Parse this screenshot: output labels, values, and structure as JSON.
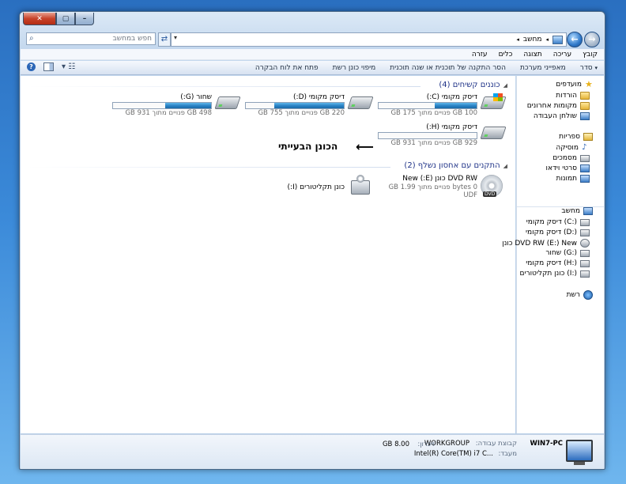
{
  "window": {
    "address": {
      "breadcrumb": "מחשב",
      "search_placeholder": "חפש במחשב"
    },
    "menu": [
      "קובץ",
      "עריכה",
      "תצוגה",
      "כלים",
      "עזרה"
    ],
    "toolbar": [
      "סדר",
      "מאפייני מערכת",
      "הסר התקנה של תוכנית או שנה תוכנית",
      "מיפוי כונן רשת",
      "פתח את לוח הבקרה"
    ]
  },
  "groups": {
    "hdd_title": "כוננים קשיחים (4)",
    "removable_title": "התקנים עם אחסון נשלף (2)"
  },
  "drives": [
    {
      "name": "דיסק מקומי (C:)",
      "free": "100 GB פנויים מתוך 175 GB",
      "used_fraction": 0.43
    },
    {
      "name": "דיסק מקומי (D:)",
      "free": "220 GB פנויים מתוך 755 GB",
      "used_fraction": 0.71
    },
    {
      "name": "שחור (G:)",
      "free": "498 GB פנויים מתוך 931 GB",
      "used_fraction": 0.47
    },
    {
      "name": "דיסק מקומי (H:)",
      "free": "929 GB פנויים מתוך 931 GB",
      "used_fraction": 0.002
    }
  ],
  "removable": [
    {
      "name": "DVD RW כונן (E:) New",
      "line2": "0 bytes פנויים מתוך 1.99 GB",
      "line3": "UDF"
    },
    {
      "name": "כונן תקליטורים (I:)"
    }
  ],
  "annotation": "הכונן הבעייתי",
  "annotation_arrow": "⟵",
  "nav": {
    "favorites": "מועדפים",
    "downloads": "הורדות",
    "recent": "מקומות אחרונים",
    "desktop": "שולחן העבודה",
    "libraries": "ספריות",
    "music": "מוסיקה",
    "documents": "מסמכים",
    "videos": "סרטי וידאו",
    "pictures": "תמונות",
    "computer": "מחשב",
    "c": "דיסק מקומי (C:)",
    "d": "דיסק מקומי (D:)",
    "e": "כונן DVD RW (E:) New",
    "g": "שחור (G:)",
    "h": "דיסק מקומי (H:)",
    "i": "כונן תקליטורים (I:)",
    "network": "רשת"
  },
  "details": {
    "pc_name": "WIN7-PC",
    "workgroup_label": "קבוצת עבודה:",
    "workgroup": "WORKGROUP",
    "memory_label": "זיכרון:",
    "memory": "8.00 GB",
    "processor_label": "מעבד:",
    "processor": "Intel(R) Core(TM) i7 C..."
  }
}
